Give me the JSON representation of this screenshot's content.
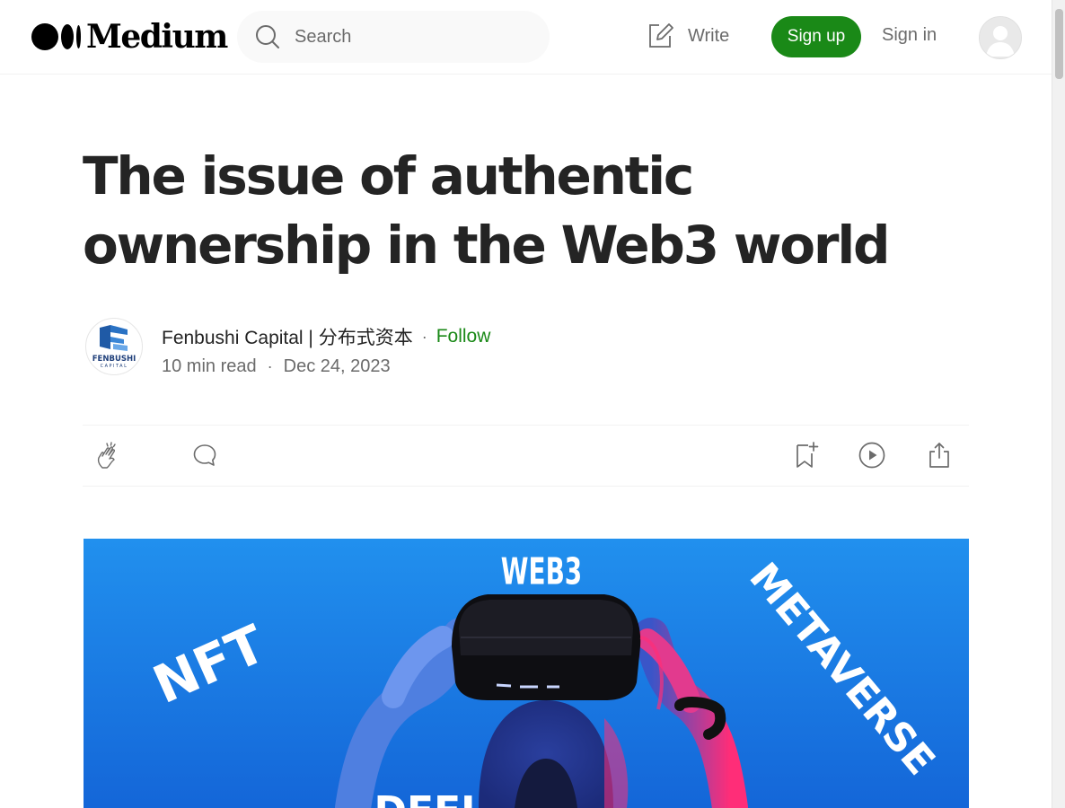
{
  "header": {
    "brand": "Medium",
    "search_placeholder": "Search",
    "write_label": "Write",
    "signup_label": "Sign up",
    "signin_label": "Sign in"
  },
  "article": {
    "title": "The issue of authentic ownership in the Web3 world",
    "author": "Fenbushi Capital | 分布式资本",
    "follow_label": "Follow",
    "read_time": "10 min read",
    "date": "Dec 24, 2023",
    "author_logo_text": "FENBUSHI",
    "author_logo_subtext": "CAPITAL"
  },
  "hero": {
    "words": [
      "WEB3",
      "NFT",
      "METAVERSE",
      "DEFI"
    ]
  },
  "icons": {
    "clap": "clap-icon",
    "comment": "comment-icon",
    "bookmark": "bookmark-add-icon",
    "listen": "play-circle-icon",
    "share": "share-icon",
    "search": "search-icon",
    "write": "write-icon"
  },
  "colors": {
    "accent_green": "#1a8917",
    "hero_blue": "#1a74de",
    "text": "#242424",
    "muted": "#6b6b6b"
  }
}
